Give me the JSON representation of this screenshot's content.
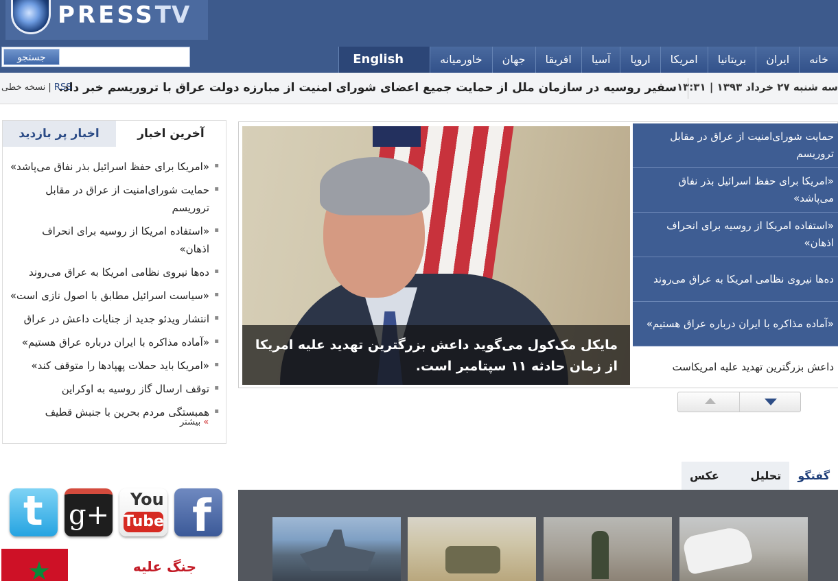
{
  "header": {
    "logo_text": "PRESS",
    "logo_tv": "TV"
  },
  "search": {
    "button_label": "جستجو",
    "placeholder": ""
  },
  "nav": {
    "items": [
      "خانه",
      "ایران",
      "بریتانیا",
      "امریکا",
      "اروپا",
      "آسیا",
      "افریقا",
      "جهان",
      "خاورمیانه"
    ],
    "english": "English"
  },
  "ticker": {
    "date": "سه شنبه ۲۷ خرداد ۱۳۹۳ | ۱۳:۳۱",
    "news": "سفیر روسیه در سازمان ملل از حمایت جمیع اعضای شورای امنیت از مبارزه دولت عراق با تروریسم خبر داد.",
    "rss": "RSS",
    "separator": "|",
    "text_version": "نسخه خطی"
  },
  "latest": {
    "tab_latest": "آخرین اخبار",
    "tab_popular": "اخبار پر بازدید",
    "items": [
      "«امریکا برای حفظ اسرائیل بذر نفاق می‌پاشد»",
      "حمایت شورای‌امنیت از عراق در مقابل تروریسم",
      "«استفاده امریکا از روسیه برای انحراف اذهان»",
      "ده‌ها نیروی نظامی امریکا به عراق می‌روند",
      "«سیاست اسرائیل مطابق با اصول نازی است»",
      "انتشار ویدئو جدید از جنایات داعش در عراق",
      "«آماده مذاکره با ایران درباره عراق هستیم»",
      "«امریکا باید حملات پهپادها را متوقف کند»",
      "توقف ارسال گاز روسیه به اوکراین",
      "همبستگی مردم بحرین با جنبش قطیف"
    ],
    "more": "بیشتر",
    "more_arrow": "»"
  },
  "feature": {
    "caption": "مایکل مک‌کول می‌گوید داعش بزرگترین تهدید علیه امریکا از زمان حادثه ۱۱ سپتامبر است."
  },
  "headlines": [
    "حمایت شورای‌امنیت از عراق در مقابل تروریسم",
    "«امریکا برای حفظ اسرائیل بذر نفاق می‌پاشد»",
    "«استفاده امریکا از روسیه برای انحراف اذهان»",
    "ده‌ها نیروی نظامی امریکا به عراق می‌روند",
    "«آماده مذاکره با ایران درباره عراق هستیم»",
    "داعش بزرگترین تهدید علیه امریکاست"
  ],
  "bottom_tabs": [
    "گفتگو",
    "تحلیل",
    "عکس روز"
  ],
  "banner": {
    "text": "جنگ علیه"
  }
}
